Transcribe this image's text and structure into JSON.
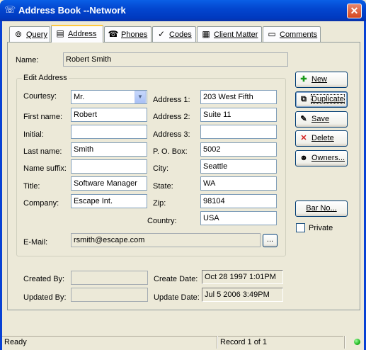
{
  "window": {
    "title": "Address Book --Network",
    "close_glyph": "✕",
    "app_icon": "address-book-icon"
  },
  "tabs": [
    {
      "label": "Query",
      "icon": "binoculars-icon",
      "glyph": "⊚"
    },
    {
      "label": "Address",
      "icon": "address-card-icon",
      "glyph": "▤"
    },
    {
      "label": "Phones",
      "icon": "telephone-icon",
      "glyph": "☎"
    },
    {
      "label": "Codes",
      "icon": "checkmark-icon",
      "glyph": "✓"
    },
    {
      "label": "Client Matter",
      "icon": "file-cabinet-icon",
      "glyph": "▦"
    },
    {
      "label": "Comments",
      "icon": "notepad-icon",
      "glyph": "▭"
    }
  ],
  "name": {
    "label": "Name:",
    "value": "Robert Smith"
  },
  "edit_address": {
    "legend": "Edit Address",
    "courtesy": {
      "label": "Courtesy:",
      "value": "Mr."
    },
    "first_name": {
      "label": "First name:",
      "value": "Robert"
    },
    "initial": {
      "label": "Initial:",
      "value": ""
    },
    "last_name": {
      "label": "Last name:",
      "value": "Smith"
    },
    "name_suffix": {
      "label": "Name suffix:",
      "value": ""
    },
    "title": {
      "label": "Title:",
      "value": "Software Manager"
    },
    "company": {
      "label": "Company:",
      "value": "Escape Int."
    },
    "address1": {
      "label": "Address 1:",
      "value": "203 West Fifth"
    },
    "address2": {
      "label": "Address 2:",
      "value": "Suite 11"
    },
    "address3": {
      "label": "Address 3:",
      "value": ""
    },
    "po_box": {
      "label": "P. O. Box:",
      "value": "5002"
    },
    "city": {
      "label": "City:",
      "value": "Seattle"
    },
    "state": {
      "label": "State:",
      "value": "WA"
    },
    "zip": {
      "label": "Zip:",
      "value": "98104"
    },
    "country": {
      "label": "Country:",
      "value": "USA"
    },
    "email": {
      "label": "E-Mail:",
      "value": "rsmith@escape.com",
      "browse_label": "..."
    }
  },
  "buttons": {
    "new": {
      "label": "New",
      "glyph": "✚"
    },
    "duplicate": {
      "label": "Duplicate",
      "glyph": "⧉"
    },
    "save": {
      "label": "Save",
      "glyph": "✎"
    },
    "delete": {
      "label": "Delete",
      "glyph": "✕"
    },
    "owners": {
      "label": "Owners...",
      "glyph": "☻"
    },
    "bar_no": {
      "label": "Bar No..."
    }
  },
  "private": {
    "label": "Private",
    "checked": false
  },
  "audit": {
    "created_by": {
      "label": "Created By:",
      "value": ""
    },
    "updated_by": {
      "label": "Updated By:",
      "value": ""
    },
    "create_date": {
      "label": "Create Date:",
      "value": "Oct 28 1997  1:01PM"
    },
    "update_date": {
      "label": "Update Date:",
      "value": "Jul  5 2006  3:49PM"
    }
  },
  "status": {
    "left": "Ready",
    "record": "Record 1 of 1"
  },
  "colors": {
    "titlebar": "#0347d0",
    "accent_tab": "#ffc83c",
    "new_icon": "#1a9a1a",
    "delete_icon": "#d42020",
    "status_led": "#22aa22"
  }
}
